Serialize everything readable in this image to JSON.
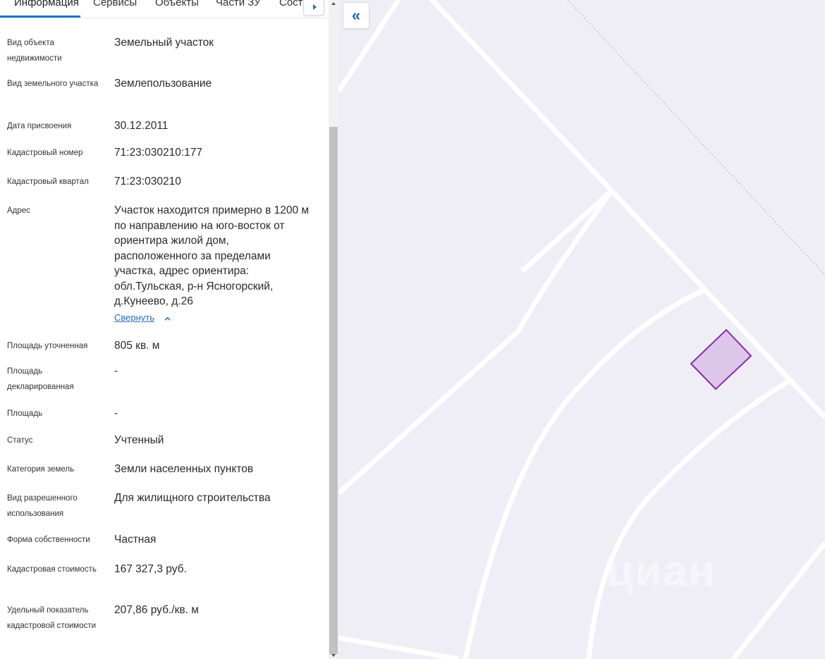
{
  "tabs": [
    {
      "label": "Информация"
    },
    {
      "label": "Сервисы"
    },
    {
      "label": "Объекты"
    },
    {
      "label": "Части ЗУ"
    },
    {
      "label": "Соста"
    }
  ],
  "info": [
    {
      "label": "Вид объекта недвижимости",
      "value": "Земельный участок"
    },
    {
      "label": "Вид земельного участка",
      "value": "Землепользование"
    },
    {
      "label": "Дата присвоения",
      "value": "30.12.2011"
    },
    {
      "label": "Кадастровый номер",
      "value": "71:23:030210:177"
    },
    {
      "label": "Кадастровый квартал",
      "value": "71:23:030210"
    },
    {
      "label": "Адрес",
      "value": "Участок находится примерно в 1200 м по направлению на юго-восток от ориентира жилой дом, расположенного за пределами участка, адрес ориентира: обл.Тульская, р-н Ясногорский, д.Кунеево, д.26"
    },
    {
      "label": "Площадь уточненная",
      "value": "805 кв. м"
    },
    {
      "label": "Площадь декларированная",
      "value": "-"
    },
    {
      "label": "Площадь",
      "value": "-"
    },
    {
      "label": "Статус",
      "value": "Учтенный"
    },
    {
      "label": "Категория земель",
      "value": "Земли населенных пунктов"
    },
    {
      "label": "Вид разрешенного использования",
      "value": "Для жилищного строительства"
    },
    {
      "label": "Форма собственности",
      "value": "Частная"
    },
    {
      "label": "Кадастровая стоимость",
      "value": "167 327,3 руб."
    },
    {
      "label": "Удельный показатель кадастровой стоимости",
      "value": "207,86 руб./кв. м"
    }
  ],
  "address_collapse_label": "Свернуть",
  "map": {
    "collapse_icon": "double-chevron-left-icon",
    "watermark": "циан",
    "parcel_fill": "#dcc6ea",
    "parcel_stroke": "#8a2ba8",
    "background": "#efeef6"
  }
}
